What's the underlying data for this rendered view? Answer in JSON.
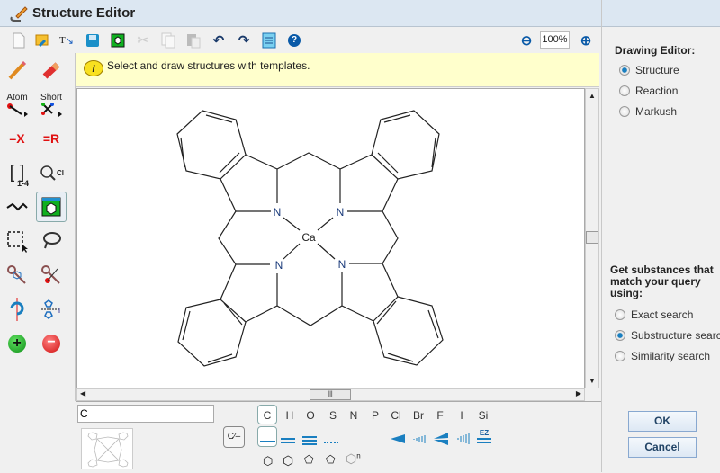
{
  "window": {
    "title": "Structure Editor"
  },
  "toolbar": {
    "zoom": "100%",
    "icons": [
      "new-file",
      "open",
      "text-to-structure",
      "save",
      "template",
      "cut",
      "copy",
      "paste",
      "undo",
      "redo",
      "document-list",
      "help",
      "zoom-out",
      "zoom-in"
    ]
  },
  "left_tools": {
    "atom_label": "Atom",
    "short_label": "Short",
    "x_label": "X",
    "r_label": "R",
    "bracket_label": "1-4",
    "ring_label": "Cl"
  },
  "info": {
    "message": "Select and draw structures with templates."
  },
  "molecule": {
    "atoms": {
      "n1": "N",
      "n2": "N",
      "n3": "N",
      "n4": "N",
      "ca": "Ca"
    }
  },
  "bottom": {
    "atom_input": "C",
    "elements": [
      "C",
      "H",
      "O",
      "S",
      "N",
      "P",
      "Cl",
      "Br",
      "F",
      "I",
      "Si"
    ],
    "ez_label": "EZ",
    "ring_n": "n",
    "charge_label": "C"
  },
  "right": {
    "drawing_editor_title": "Drawing Editor:",
    "editor_modes": [
      "Structure",
      "Reaction",
      "Markush"
    ],
    "selected_mode": "Structure",
    "search_title": "Get substances that match your query using:",
    "search_types": [
      "Exact search",
      "Substructure search",
      "Similarity search"
    ],
    "selected_search": "Substructure search",
    "ok": "OK",
    "cancel": "Cancel"
  },
  "colors": {
    "titlebar": "#dce7f2",
    "info_bg": "#ffffcc",
    "accent": "#1a7fc0"
  }
}
